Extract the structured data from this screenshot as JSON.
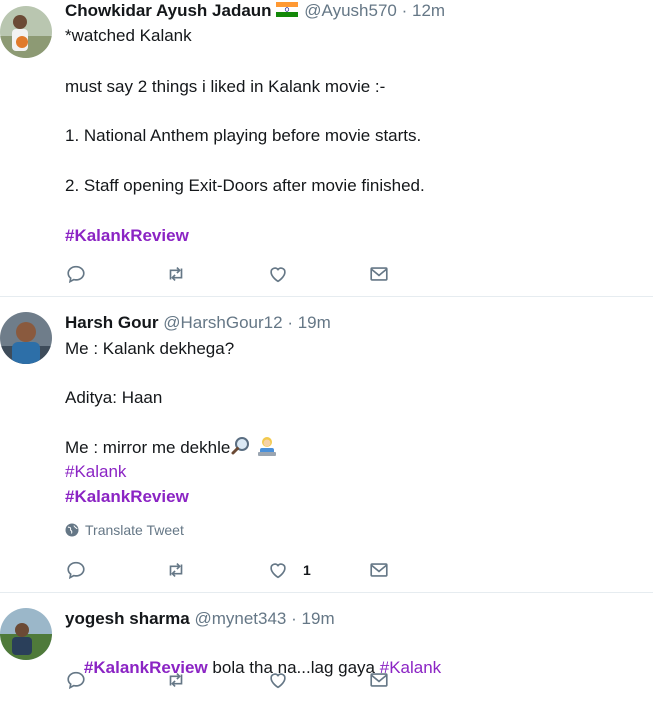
{
  "tweets": [
    {
      "name": "Chowkidar Ayush Jadaun",
      "handle": "@Ayush570",
      "sep": "·",
      "time": "12m",
      "lines": {
        "l1": "*watched Kalank",
        "l2": "must say 2 things i liked in Kalank movie :-",
        "l3": "1. National Anthem playing before movie starts.",
        "l4": "2. Staff opening Exit-Doors after movie finished."
      },
      "hashtag": "#KalankReview",
      "flag_icon": "india-flag-icon"
    },
    {
      "name": "Harsh Gour",
      "handle": "@HarshGour12",
      "sep": "·",
      "time": "19m",
      "lines": {
        "l1": "Me : Kalank dekhega?",
        "l2": "Aditya: Haan",
        "l3": "Me : mirror me dekhle"
      },
      "hashtag1": "#Kalank",
      "hashtag2": "#KalankReview",
      "translate": "Translate Tweet",
      "like_count": "1"
    },
    {
      "name": "yogesh sharma",
      "handle": "@mynet343",
      "sep": "·",
      "time": "19m",
      "hashtag1": "#KalankReview",
      "middle": " bola tha na...lag gaya ",
      "hashtag2": "#Kalank"
    }
  ],
  "colors": {
    "hashtag": "#8b24c4",
    "muted": "#657786",
    "divider": "#e6ecf0"
  }
}
